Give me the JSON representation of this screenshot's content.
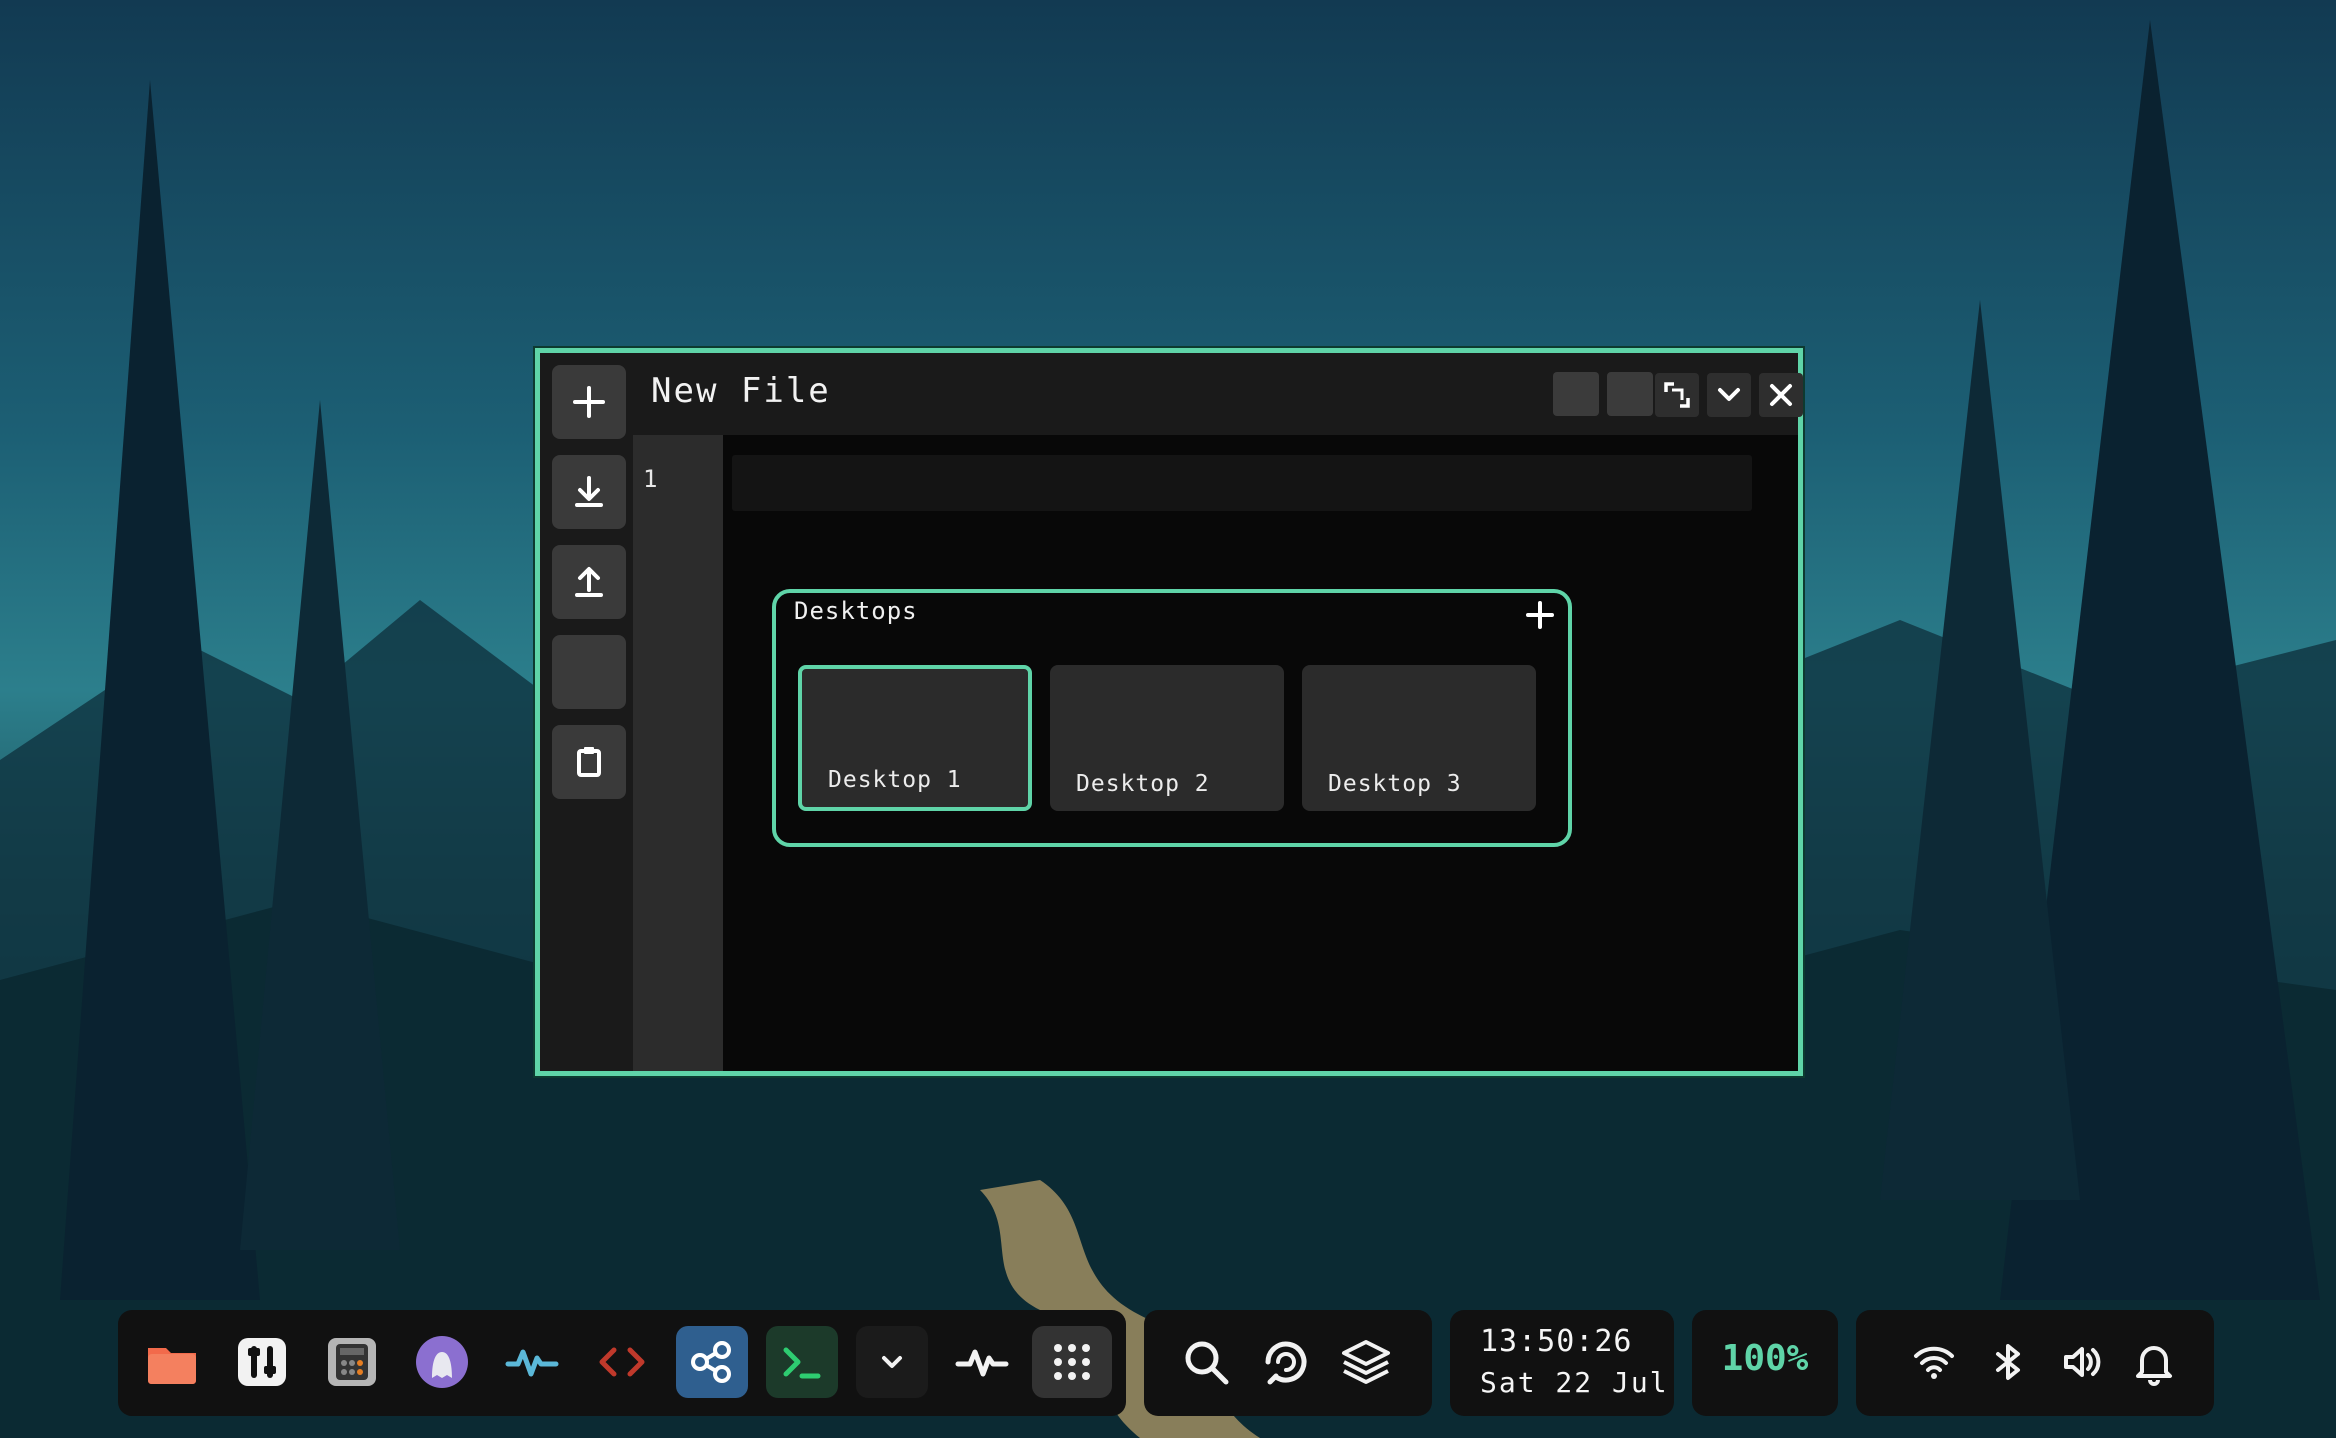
{
  "window": {
    "title": "New File",
    "line_number": "1",
    "toolbar": [
      {
        "icon": "plus-icon",
        "name": "new-file-button"
      },
      {
        "icon": "download-icon",
        "name": "save-button"
      },
      {
        "icon": "upload-icon",
        "name": "open-button"
      },
      {
        "icon": "blank",
        "name": "empty-tool-button"
      },
      {
        "icon": "clipboard-icon",
        "name": "clipboard-button"
      }
    ],
    "controls": [
      "resize-icon",
      "minimize-icon",
      "close-icon"
    ]
  },
  "desktops": {
    "title": "Desktops",
    "items": [
      {
        "label": "Desktop 1",
        "active": true
      },
      {
        "label": "Desktop 2",
        "active": false
      },
      {
        "label": "Desktop 3",
        "active": false
      }
    ]
  },
  "dock": {
    "apps": [
      {
        "icon": "folder-icon",
        "color": "#f26a4b"
      },
      {
        "icon": "settings-sliders-icon",
        "color": "#f2f2f2"
      },
      {
        "icon": "calculator-icon",
        "color": "#9a9a9a"
      },
      {
        "icon": "ghost-icon",
        "color": "#8b6fd0"
      },
      {
        "icon": "activity-icon",
        "color": "#5bb8d8"
      },
      {
        "icon": "code-icon",
        "color": "#c0392b"
      },
      {
        "icon": "share-icon",
        "color": "#2f6fa8"
      },
      {
        "icon": "terminal-icon",
        "color": "#2ecc71"
      },
      {
        "icon": "chevron-down-icon",
        "color": "#f2f2f2"
      },
      {
        "icon": "heartbeat-icon",
        "color": "#f2f2f2"
      },
      {
        "icon": "app-grid-icon",
        "color": "#f2f2f2"
      }
    ]
  },
  "quick_actions": [
    "search-icon",
    "refresh-icon",
    "layers-icon"
  ],
  "clock": {
    "time": "13:50:26",
    "date": "Sat 22 Jul"
  },
  "battery": {
    "level": "100%"
  },
  "tray": [
    "wifi-icon",
    "bluetooth-icon",
    "volume-icon",
    "bell-icon"
  ],
  "colors": {
    "accent": "#5fd4a8",
    "panel": "#111111"
  }
}
